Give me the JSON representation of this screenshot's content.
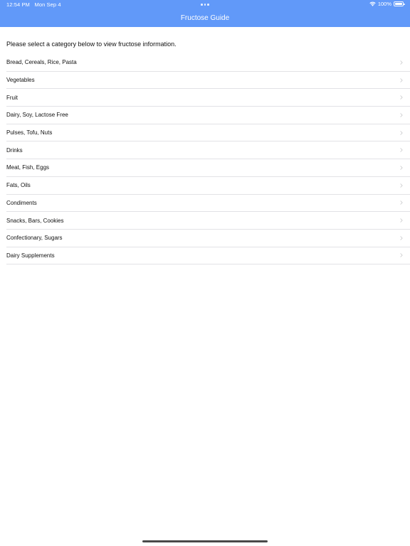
{
  "status_bar": {
    "time": "12:54 PM",
    "date": "Mon Sep 4",
    "battery": "100%",
    "battery_level": 1.0
  },
  "nav": {
    "title": "Fructose Guide"
  },
  "intro_text": "Please select a category below to view fructose information.",
  "categories": [
    {
      "label": "Bread, Cereals, Rice, Pasta"
    },
    {
      "label": "Vegetables"
    },
    {
      "label": "Fruit"
    },
    {
      "label": "Dairy, Soy, Lactose Free"
    },
    {
      "label": "Pulses, Tofu, Nuts"
    },
    {
      "label": "Drinks"
    },
    {
      "label": "Meat, Fish, Eggs"
    },
    {
      "label": "Fats, Oils"
    },
    {
      "label": "Condiments"
    },
    {
      "label": "Snacks, Bars, Cookies"
    },
    {
      "label": "Confectionary, Sugars"
    },
    {
      "label": "Dairy Supplements"
    }
  ],
  "colors": {
    "nav_background": "#6199f9",
    "separator": "#e2e2e6",
    "chevron": "#c4c4c7"
  }
}
